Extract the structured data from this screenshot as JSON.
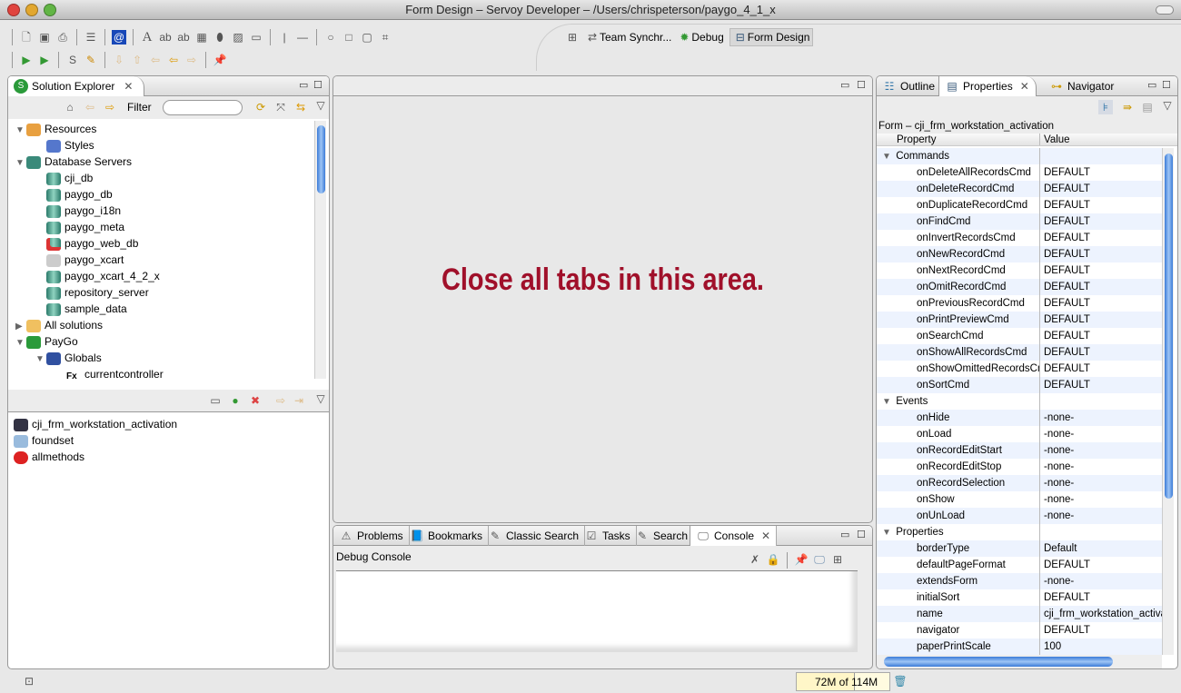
{
  "window": {
    "title": "Form Design – Servoy Developer – /Users/chrispeterson/paygo_4_1_x"
  },
  "perspectives": [
    {
      "label": "",
      "icon": "open-perspective-icon"
    },
    {
      "label": "Team Synchr...",
      "icon": "team-sync-icon"
    },
    {
      "label": "Debug",
      "icon": "bug-icon"
    },
    {
      "label": "Form Design",
      "icon": "form-design-icon",
      "active": true
    }
  ],
  "solution_explorer": {
    "tab": "Solution Explorer",
    "filter_label": "Filter",
    "filter_value": "",
    "tree": [
      {
        "label": "Resources",
        "level": 0,
        "expanded": true,
        "icon": "resources-icon"
      },
      {
        "label": "Styles",
        "level": 1,
        "icon": "styles-icon"
      },
      {
        "label": "Database Servers",
        "level": 0,
        "expanded": true,
        "icon": "db-servers-icon"
      },
      {
        "label": "cji_db",
        "level": 1,
        "icon": "database-icon"
      },
      {
        "label": "paygo_db",
        "level": 1,
        "icon": "database-icon"
      },
      {
        "label": "paygo_i18n",
        "level": 1,
        "icon": "database-icon"
      },
      {
        "label": "paygo_meta",
        "level": 1,
        "icon": "database-icon"
      },
      {
        "label": "paygo_web_db",
        "level": 1,
        "icon": "database-error-icon"
      },
      {
        "label": "paygo_xcart",
        "level": 1,
        "icon": "database-disabled-icon"
      },
      {
        "label": "paygo_xcart_4_2_x",
        "level": 1,
        "icon": "database-icon"
      },
      {
        "label": "repository_server",
        "level": 1,
        "icon": "database-icon"
      },
      {
        "label": "sample_data",
        "level": 1,
        "icon": "database-icon"
      },
      {
        "label": "All solutions",
        "level": 0,
        "expanded": false,
        "icon": "folder-icon"
      },
      {
        "label": "PayGo",
        "level": 0,
        "expanded": true,
        "icon": "solution-icon"
      },
      {
        "label": "Globals",
        "level": 1,
        "expanded": true,
        "icon": "globe-icon"
      },
      {
        "label": "currentcontroller",
        "level": 2,
        "icon": "function-icon"
      }
    ],
    "list": [
      {
        "label": "cji_frm_workstation_activation",
        "icon": "form-icon"
      },
      {
        "label": "foundset",
        "icon": "foundset-icon"
      },
      {
        "label": "allmethods",
        "icon": "method-icon"
      }
    ]
  },
  "editor": {
    "message": "Close all tabs in this area.",
    "message_color": "#a0102a"
  },
  "console": {
    "tabs": [
      "Problems",
      "Bookmarks",
      "Classic Search",
      "Tasks",
      "Search",
      "Console"
    ],
    "active_tab": "Console",
    "title": "Debug Console"
  },
  "properties": {
    "tabs": [
      "Outline",
      "Properties",
      "Navigator"
    ],
    "active_tab": "Properties",
    "form_title": "Form – cji_frm_workstation_activation",
    "col_property": "Property",
    "col_value": "Value",
    "rows": [
      {
        "k": "Commands",
        "cat": true
      },
      {
        "k": "onDeleteAllRecordsCmd",
        "v": "DEFAULT"
      },
      {
        "k": "onDeleteRecordCmd",
        "v": "DEFAULT"
      },
      {
        "k": "onDuplicateRecordCmd",
        "v": "DEFAULT"
      },
      {
        "k": "onFindCmd",
        "v": "DEFAULT"
      },
      {
        "k": "onInvertRecordsCmd",
        "v": "DEFAULT"
      },
      {
        "k": "onNewRecordCmd",
        "v": "DEFAULT"
      },
      {
        "k": "onNextRecordCmd",
        "v": "DEFAULT"
      },
      {
        "k": "onOmitRecordCmd",
        "v": "DEFAULT"
      },
      {
        "k": "onPreviousRecordCmd",
        "v": "DEFAULT"
      },
      {
        "k": "onPrintPreviewCmd",
        "v": "DEFAULT"
      },
      {
        "k": "onSearchCmd",
        "v": "DEFAULT"
      },
      {
        "k": "onShowAllRecordsCmd",
        "v": "DEFAULT"
      },
      {
        "k": "onShowOmittedRecordsCmd",
        "v": "DEFAULT"
      },
      {
        "k": "onSortCmd",
        "v": "DEFAULT"
      },
      {
        "k": "Events",
        "cat": true
      },
      {
        "k": "onHide",
        "v": "-none-"
      },
      {
        "k": "onLoad",
        "v": "-none-"
      },
      {
        "k": "onRecordEditStart",
        "v": "-none-"
      },
      {
        "k": "onRecordEditStop",
        "v": "-none-"
      },
      {
        "k": "onRecordSelection",
        "v": "-none-"
      },
      {
        "k": "onShow",
        "v": "-none-"
      },
      {
        "k": "onUnLoad",
        "v": "-none-"
      },
      {
        "k": "Properties",
        "cat": true
      },
      {
        "k": "borderType",
        "v": "Default"
      },
      {
        "k": "defaultPageFormat",
        "v": "DEFAULT"
      },
      {
        "k": "extendsForm",
        "v": "-none-"
      },
      {
        "k": "initialSort",
        "v": "DEFAULT"
      },
      {
        "k": "name",
        "v": "cji_frm_workstation_activation"
      },
      {
        "k": "navigator",
        "v": "DEFAULT"
      },
      {
        "k": "paperPrintScale",
        "v": "100"
      }
    ]
  },
  "status": {
    "memory": "72M of 114M",
    "memory_used_fraction": 0.63
  }
}
